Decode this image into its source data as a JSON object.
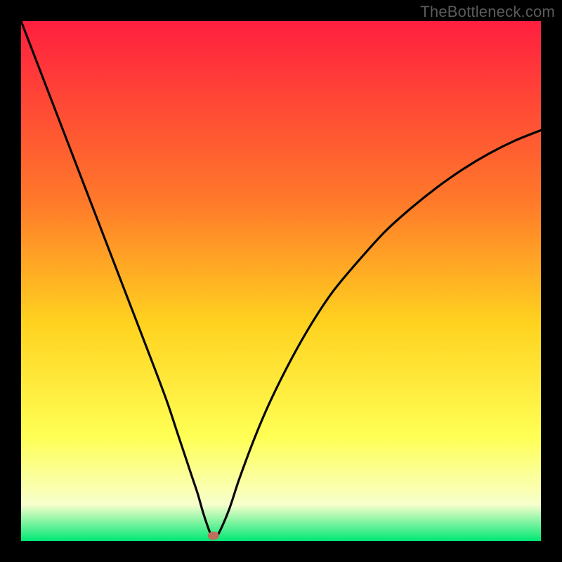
{
  "attribution": "TheBottleneck.com",
  "colors": {
    "frame": "#000000",
    "gradient_top": "#ff1f3f",
    "gradient_mid1": "#ff7a2a",
    "gradient_mid2": "#ffd21f",
    "gradient_mid3": "#ffff55",
    "gradient_mid4": "#f8ffcc",
    "gradient_bottom": "#00e874",
    "curve": "#070707",
    "marker": "#be6e5c"
  },
  "chart_data": {
    "type": "line",
    "title": "",
    "xlabel": "",
    "ylabel": "",
    "xlim": [
      0,
      100
    ],
    "ylim": [
      0,
      100
    ],
    "series": [
      {
        "name": "bottleneck-curve",
        "x": [
          0,
          5,
          10,
          15,
          20,
          25,
          28,
          30,
          31,
          32,
          33,
          34,
          35,
          36,
          36.5,
          37,
          37.5,
          38,
          40,
          42,
          45,
          48,
          52,
          56,
          60,
          65,
          70,
          75,
          80,
          85,
          90,
          95,
          100
        ],
        "values": [
          100,
          87,
          74,
          61,
          48,
          35,
          27,
          21,
          18,
          15,
          12,
          9,
          5.5,
          2.5,
          1.3,
          1,
          1.1,
          1.4,
          6,
          12,
          20,
          27,
          35,
          42,
          48,
          54,
          59.5,
          64,
          68,
          71.5,
          74.5,
          77,
          79
        ]
      }
    ],
    "marker": {
      "x": 37,
      "y": 1
    },
    "annotations": []
  }
}
